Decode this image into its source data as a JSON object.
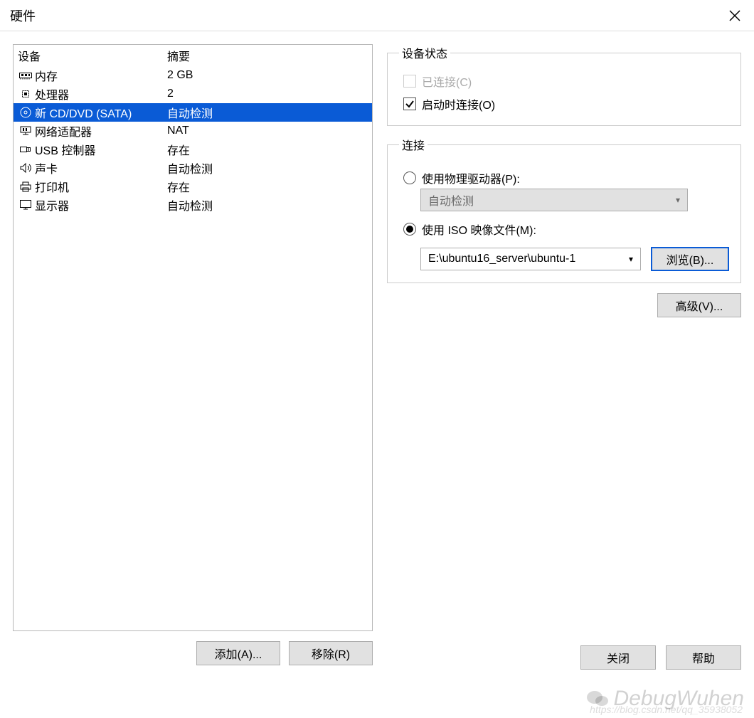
{
  "window": {
    "title": "硬件"
  },
  "deviceList": {
    "headers": {
      "device": "设备",
      "summary": "摘要"
    },
    "rows": [
      {
        "icon": "memory-icon",
        "name": "内存",
        "summary": "2 GB",
        "selected": false
      },
      {
        "icon": "cpu-icon",
        "name": "处理器",
        "summary": "2",
        "selected": false
      },
      {
        "icon": "disc-icon",
        "name": "新 CD/DVD (SATA)",
        "summary": "自动检测",
        "selected": true
      },
      {
        "icon": "network-icon",
        "name": "网络适配器",
        "summary": "NAT",
        "selected": false
      },
      {
        "icon": "usb-icon",
        "name": "USB 控制器",
        "summary": "存在",
        "selected": false
      },
      {
        "icon": "sound-icon",
        "name": "声卡",
        "summary": "自动检测",
        "selected": false
      },
      {
        "icon": "printer-icon",
        "name": "打印机",
        "summary": "存在",
        "selected": false
      },
      {
        "icon": "display-icon",
        "name": "显示器",
        "summary": "自动检测",
        "selected": false
      }
    ]
  },
  "buttons": {
    "add": "添加(A)...",
    "remove": "移除(R)",
    "browse": "浏览(B)...",
    "advanced": "高级(V)...",
    "close": "关闭",
    "help": "帮助"
  },
  "status": {
    "legend": "设备状态",
    "connected": {
      "label": "已连接(C)",
      "checked": false,
      "enabled": false
    },
    "connectAtPowerOn": {
      "label": "启动时连接(O)",
      "checked": true,
      "enabled": true
    }
  },
  "connection": {
    "legend": "连接",
    "physical": {
      "label": "使用物理驱动器(P):",
      "selected": false,
      "dropdown": "自动检测",
      "enabled": false
    },
    "iso": {
      "label": "使用 ISO 映像文件(M):",
      "selected": true,
      "path": "E:\\ubuntu16_server\\ubuntu-1"
    }
  },
  "watermark": {
    "text": "DebugWuhen",
    "url": "https://blog.csdn.net/qq_35938052"
  }
}
